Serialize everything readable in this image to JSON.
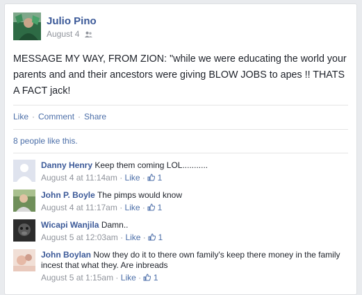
{
  "post": {
    "author": "Julio Pino",
    "date": "August 4",
    "audience_icon": "friends-icon",
    "text": "MESSAGE MY WAY, FROM ZION: \"while we were educating the world your parents and and their ancestors were giving BLOW JOBS to apes !! THATS A FACT jack!"
  },
  "actions": {
    "like": "Like",
    "comment": "Comment",
    "share": "Share",
    "separator": "·"
  },
  "likes_summary": "8 people like this.",
  "comments": [
    {
      "name": "Danny Henry",
      "text": "Keep them coming LOL...........",
      "time": "August 4 at 11:14am",
      "like_label": "Like",
      "like_count": "1"
    },
    {
      "name": "John P. Boyle",
      "text": "The pimps would know",
      "time": "August 4 at 11:17am",
      "like_label": "Like",
      "like_count": "1"
    },
    {
      "name": "Wicapi Wanjila",
      "text": "Damn..",
      "time": "August 5 at 12:03am",
      "like_label": "Like",
      "like_count": "1"
    },
    {
      "name": "John Boylan",
      "text": "Now they do it to there own family's keep there money in the family incest that what they. Are inbreads",
      "time": "August 5 at 1:15am",
      "like_label": "Like",
      "like_count": "1"
    }
  ],
  "colors": {
    "link": "#3b5998",
    "action": "#4b6ea8",
    "meta": "#90949c"
  }
}
